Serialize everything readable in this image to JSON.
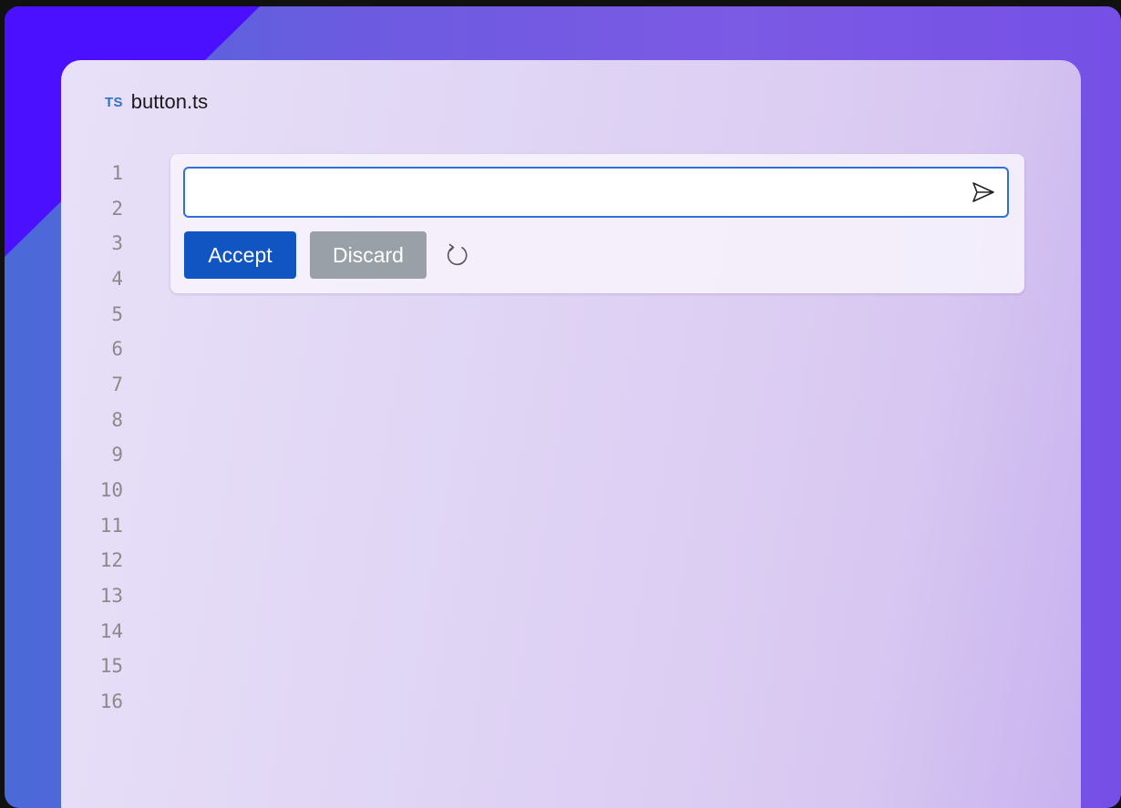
{
  "file": {
    "language_badge": "TS",
    "name": "button.ts"
  },
  "gutter": {
    "line_numbers": [
      "1",
      "2",
      "3",
      "4",
      "5",
      "6",
      "7",
      "8",
      "9",
      "10",
      "11",
      "12",
      "13",
      "14",
      "15",
      "16"
    ]
  },
  "prompt": {
    "input_value": "",
    "placeholder": "",
    "send_icon": "send-icon"
  },
  "actions": {
    "accept_label": "Accept",
    "discard_label": "Discard",
    "regenerate_icon": "refresh-icon"
  },
  "colors": {
    "accent": "#1055c2",
    "discard": "#9aa0a8",
    "ts_badge": "#2f74c0",
    "input_border": "#2f6fd6"
  }
}
